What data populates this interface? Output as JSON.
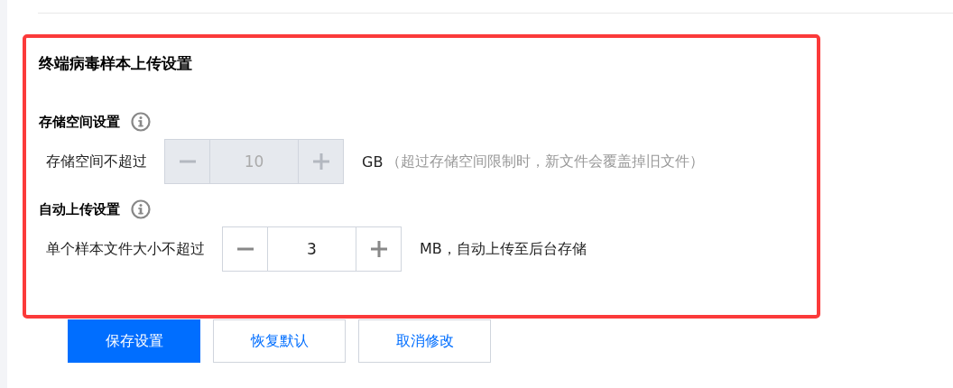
{
  "panel": {
    "title": "终端病毒样本上传设置",
    "highlighted": true,
    "sections": [
      {
        "heading": "存储空间设置",
        "row": {
          "label": "存储空间不超过",
          "value": "10",
          "disabled": true,
          "unit": "GB",
          "note": "（超过存储空间限制时，新文件会覆盖掉旧文件）"
        }
      },
      {
        "heading": "自动上传设置",
        "row": {
          "label": "单个样本文件大小不超过",
          "value": "3",
          "disabled": false,
          "unit": "MB，自动上传至后台存储"
        }
      }
    ]
  },
  "buttons": [
    {
      "label": "保存设置",
      "kind": "primary"
    },
    {
      "label": "恢复默认",
      "kind": "secondary"
    },
    {
      "label": "取消修改",
      "kind": "secondary"
    }
  ]
}
